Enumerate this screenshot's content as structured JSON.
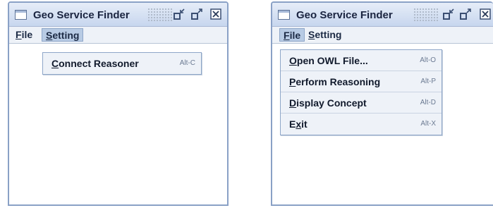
{
  "windows": [
    {
      "title": "Geo Service Finder",
      "menus": [
        {
          "mnemonic": "F",
          "rest": "ile"
        },
        {
          "mnemonic": "S",
          "rest": "etting"
        }
      ],
      "open_menu": "Setting",
      "menu_items": [
        {
          "mnemonic": "C",
          "rest": "onnect Reasoner",
          "accelerator": "Alt-C"
        }
      ]
    },
    {
      "title": "Geo Service Finder",
      "menus": [
        {
          "mnemonic": "F",
          "rest": "ile"
        },
        {
          "mnemonic": "S",
          "rest": "etting"
        }
      ],
      "open_menu": "File",
      "menu_items": [
        {
          "mnemonic": "O",
          "rest": "pen OWL File...",
          "accelerator": "Alt-O"
        },
        {
          "mnemonic": "P",
          "rest": "erform Reasoning",
          "accelerator": "Alt-P"
        },
        {
          "mnemonic": "D",
          "rest": "isplay Concept",
          "accelerator": "Alt-D"
        },
        {
          "mnemonic_prefix": "E",
          "mnemonic": "x",
          "rest": "it",
          "accelerator": "Alt-X"
        }
      ]
    }
  ],
  "icons": {
    "app": "window-icon",
    "minimize": "minimize-icon",
    "maximize": "maximize-icon",
    "close": "close-icon"
  },
  "colors": {
    "window_border": "#8aa1c6",
    "titlebar": "#c7d6ee",
    "menu_highlight": "#b8cbe4",
    "menu_background": "#eef2f8"
  }
}
